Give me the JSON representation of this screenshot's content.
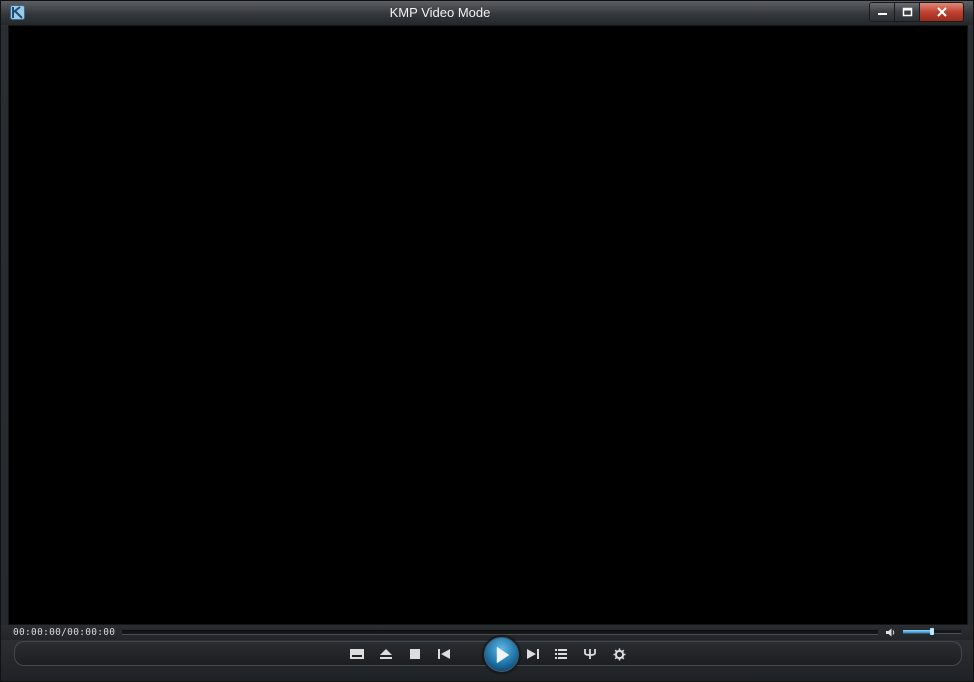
{
  "window": {
    "title": "KMP Video Mode"
  },
  "playback": {
    "time_display": "00:00:00/00:00:00",
    "seek_progress": 0,
    "volume_level": 0.5
  },
  "controls": {
    "buttons": [
      {
        "name": "subtitle-button",
        "icon": "subtitle-icon"
      },
      {
        "name": "eject-button",
        "icon": "eject-icon"
      },
      {
        "name": "stop-button",
        "icon": "stop-icon"
      },
      {
        "name": "previous-button",
        "icon": "previous-track-icon"
      },
      {
        "name": "play-button",
        "icon": "play-icon"
      },
      {
        "name": "next-button",
        "icon": "next-track-icon"
      },
      {
        "name": "playlist-button",
        "icon": "playlist-icon"
      },
      {
        "name": "equalizer-button",
        "icon": "equalizer-icon"
      },
      {
        "name": "settings-button",
        "icon": "gear-icon"
      }
    ]
  },
  "colors": {
    "accent": "#2f8fd0",
    "video_background": "#000000",
    "close_button": "#c0412f"
  }
}
